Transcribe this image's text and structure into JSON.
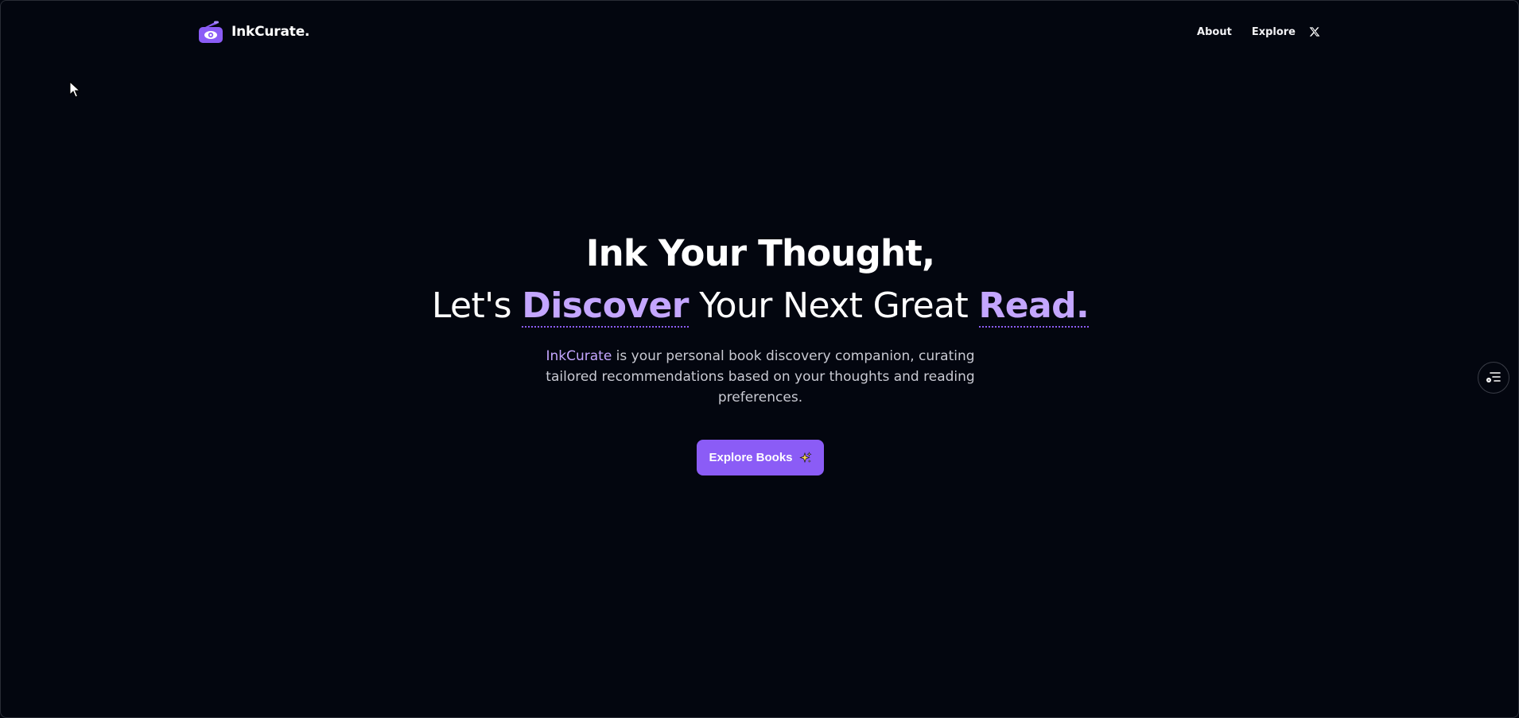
{
  "header": {
    "brand_name": "InkCurate.",
    "nav": {
      "about": "About",
      "explore": "Explore"
    },
    "social_icon": "x-icon"
  },
  "hero": {
    "title_line_1": "Ink Your Thought,",
    "title_line_2": {
      "part_1": "Let's ",
      "accent_1": "Discover",
      "part_2": " Your Next Great ",
      "accent_2": "Read."
    },
    "description": {
      "brand": "InkCurate",
      "text": " is your personal book discovery companion, curating tailored recommendations based on your thoughts and reading preferences."
    },
    "cta_label": "Explore Books",
    "cta_icon": "sparkles-icon"
  },
  "floating_button_icon": "menu-list-icon",
  "colors": {
    "background": "#03060f",
    "accent": "#8b5cf6",
    "accent_light": "#c4a6ff",
    "text": "#ffffff",
    "muted_text": "#c9cad3"
  }
}
